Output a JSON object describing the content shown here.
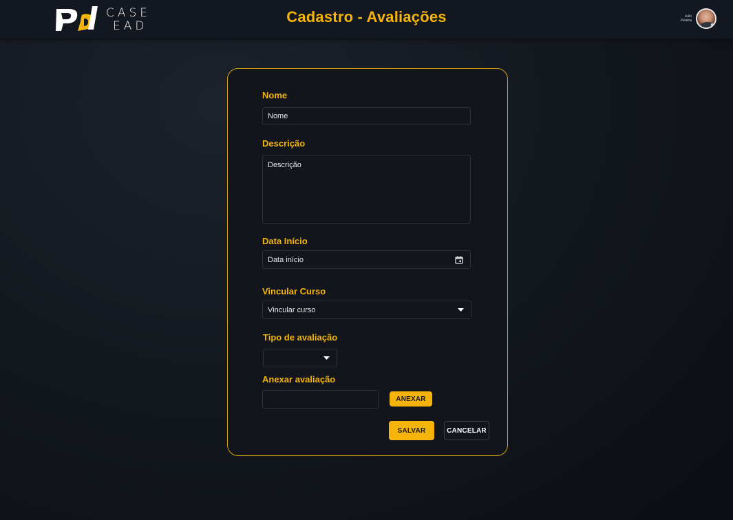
{
  "header": {
    "brand_line1": "CASE",
    "brand_line2": "EAD",
    "title": "Cadastro - Avaliações",
    "user_first": "Julio",
    "user_last": "Pereira"
  },
  "form": {
    "nome": {
      "label": "Nome",
      "placeholder": "Nome"
    },
    "descricao": {
      "label": "Descrição",
      "placeholder": "Descrição"
    },
    "data_inicio": {
      "label": "Data Início",
      "placeholder": "Data início"
    },
    "vincular_curso": {
      "label": "Vincular Curso",
      "selected": "Vincular curso"
    },
    "tipo_avaliacao": {
      "label": "Tipo de avaliação",
      "selected": ""
    },
    "anexar": {
      "label": "Anexar avaliação",
      "value": "",
      "button": "ANEXAR"
    },
    "actions": {
      "save": "SALVAR",
      "cancel": "CANCELAR"
    }
  },
  "colors": {
    "accent": "#f5b40a",
    "background": "#12161c",
    "border": "#d9a407"
  },
  "icons": [
    "calendar-icon",
    "caret-down-icon",
    "avatar"
  ]
}
